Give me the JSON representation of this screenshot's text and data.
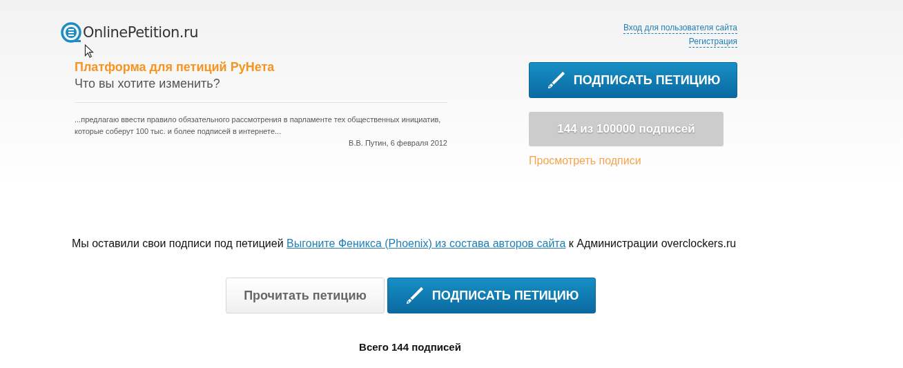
{
  "header": {
    "logo": "OnlinePetition.ru",
    "links": [
      "Вход для пользователя сайта",
      "Регистрация"
    ]
  },
  "intro": {
    "title": "Платформа для петиций РуНета",
    "subtitle": "Что вы хотите изменить?",
    "quote": "...предлагаю ввести правило обязательного рассмотрения в парламенте тех общественных инициатив, которые соберут 100 тыс. и более подписей в интернете...",
    "quote_author": "В.В. Путин, 6 февраля 2012"
  },
  "sign_panel": {
    "sign_button": "ПОДПИСАТЬ ПЕТИЦИЮ",
    "counter": "144 из 100000 подписей",
    "view_link": "Просмотреть подписи"
  },
  "message": {
    "before": "Мы оставили свои подписи под петицией ",
    "link": "Выгоните Феникса (Phoenix) из состава авторов сайта",
    "after": " к Администрации overclockers.ru"
  },
  "actions": [
    {
      "label": "Прочитать петицию",
      "kind": "secondary"
    },
    {
      "label": "ПОДПИСАТЬ ПЕТИЦИЮ",
      "kind": "primary"
    }
  ],
  "total": "Всего 144 подписей"
}
